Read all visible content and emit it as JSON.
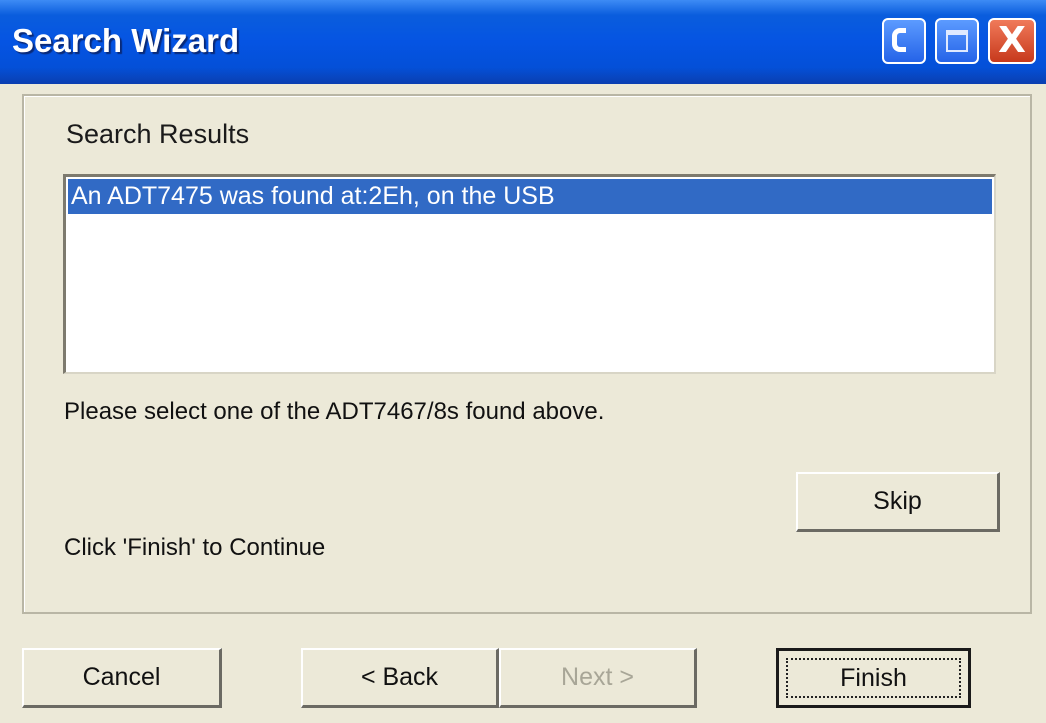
{
  "window": {
    "title": "Search Wizard",
    "controls": {
      "minimize_icon": "minimize-icon",
      "maximize_icon": "maximize-icon",
      "close_icon": "close-icon",
      "close_glyph": "X"
    }
  },
  "results": {
    "heading": "Search Results",
    "items": [
      {
        "label": "An ADT7475 was found at:2Eh, on the USB",
        "selected": true
      }
    ]
  },
  "prompt": "Please select one of the ADT7467/8s found above.",
  "continue_text": "Click 'Finish' to Continue",
  "buttons": {
    "skip": "Skip",
    "cancel": "Cancel",
    "back": "< Back",
    "next": "Next >",
    "finish": "Finish"
  },
  "colors": {
    "titlebar": "#0554e3",
    "selection": "#316ac5",
    "dialog_bg": "#ece9d8",
    "disabled_text": "#a8a697"
  }
}
